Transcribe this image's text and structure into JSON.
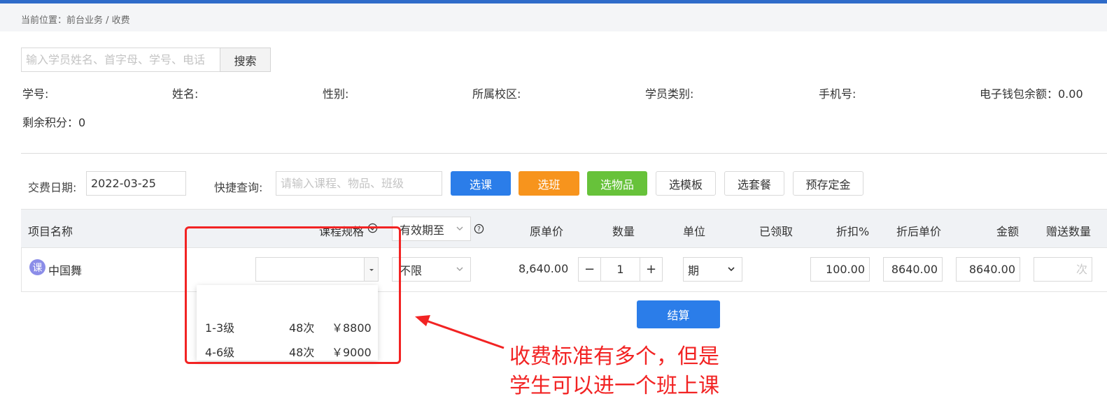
{
  "breadcrumb": "当前位置：前台业务 / 收费",
  "search": {
    "placeholder": "输入学员姓名、首字母、学号、电话",
    "button": "搜索"
  },
  "student_info": {
    "id_label": "学号:",
    "name_label": "姓名:",
    "gender_label": "性别:",
    "campus_label": "所属校区:",
    "type_label": "学员类别:",
    "phone_label": "手机号:",
    "wallet": "电子钱包余额：0.00",
    "points": "剩余积分：0"
  },
  "payment": {
    "date_label": "交费日期:",
    "date_value": "2022-03-25",
    "quick_label": "快捷查询:",
    "quick_placeholder": "请输入课程、物品、班级",
    "buttons": {
      "select_course": "选课",
      "select_class": "选班",
      "select_item": "选物品",
      "select_template": "选模板",
      "select_package": "选套餐",
      "deposit": "预存定金"
    }
  },
  "table": {
    "headers": {
      "name": "项目名称",
      "spec": "课程规格",
      "validity": "有效期至",
      "orig_price": "原单价",
      "quantity": "数量",
      "unit": "单位",
      "received": "已领取",
      "discount": "折扣%",
      "disc_price": "折后单价",
      "amount": "金额",
      "gift_qty": "赠送数量"
    },
    "row": {
      "badge": "课",
      "name": "中国舞",
      "spec_value": "",
      "validity": "不限",
      "orig_price": "8,640.00",
      "quantity": "1",
      "unit": "期",
      "discount": "100.00",
      "disc_price": "8640.00",
      "amount": "8640.00",
      "gift_placeholder": "次"
    }
  },
  "dropdown": [
    {
      "level": "1-3级",
      "times": "48次",
      "price": "￥8800"
    },
    {
      "level": "4-6级",
      "times": "48次",
      "price": "￥9000"
    }
  ],
  "settle_button": "结算",
  "annotation": {
    "line1": "收费标准有多个，但是",
    "line2": "学生可以进一个班上课"
  },
  "colors": {
    "primary": "#2b7de9",
    "orange": "#f7941d",
    "green": "#67c23a",
    "annotation_red": "#f22323"
  }
}
